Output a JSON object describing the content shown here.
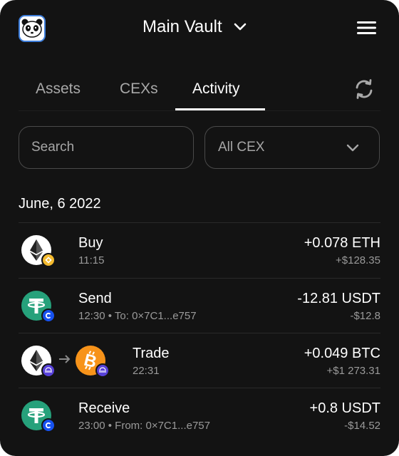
{
  "header": {
    "vault_name": "Main Vault",
    "icons": {
      "logo": "panda-logo",
      "dropdown": "chevron-down-icon",
      "menu": "hamburger-menu-icon"
    }
  },
  "tabs": [
    {
      "label": "Assets",
      "active": false
    },
    {
      "label": "CEXs",
      "active": false
    },
    {
      "label": "Activity",
      "active": true
    }
  ],
  "refresh_icon": "refresh-icon",
  "filters": {
    "search_placeholder": "Search",
    "cex_select_value": "All CEX"
  },
  "activity": {
    "date": "June, 6 2022",
    "transactions": [
      {
        "type": "Buy",
        "time": "11:15",
        "detail": "",
        "amount": "+0.078 ETH",
        "fiat": "+$128.35",
        "coin": "eth-icon",
        "exchange_badge": "binance-badge-icon"
      },
      {
        "type": "Send",
        "time": "12:30",
        "detail": "To: 0×7C1...e757",
        "amount": "-12.81 USDT",
        "fiat": "-$12.8",
        "coin": "usdt-icon",
        "exchange_badge": "coinbase-badge-icon"
      },
      {
        "type": "Trade",
        "time": "22:31",
        "detail": "",
        "amount": "+0.049 BTC",
        "fiat": "+$1 273.31",
        "coin_from": "eth-icon",
        "coin_to": "btc-icon",
        "exchange_badge": "kraken-badge-icon"
      },
      {
        "type": "Receive",
        "time": "23:00",
        "detail": "From: 0×7C1...e757",
        "amount": "+0.8 USDT",
        "fiat": "-$14.52",
        "coin": "usdt-icon",
        "exchange_badge": "coinbase-badge-icon"
      }
    ],
    "separator": "•"
  },
  "colors": {
    "background": "#131313",
    "usdt": "#26a17b",
    "btc": "#f7931a",
    "binance": "#f3ba2f",
    "coinbase": "#1652f0",
    "kraken": "#5741d9"
  }
}
